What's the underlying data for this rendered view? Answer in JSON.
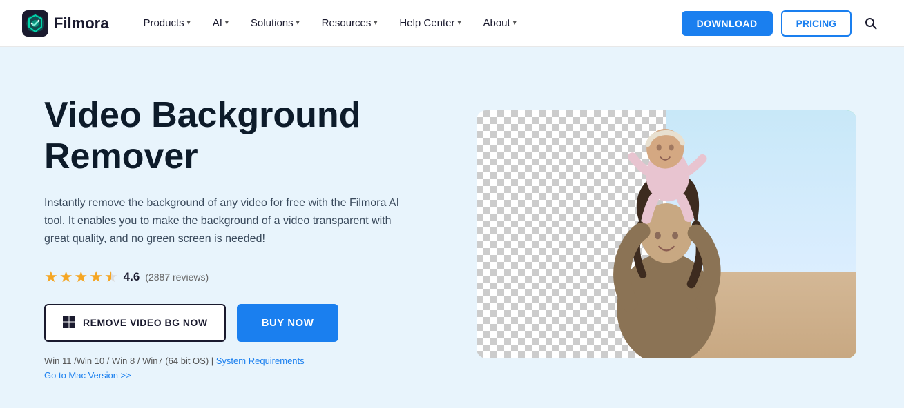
{
  "nav": {
    "logo_text": "Filmora",
    "items": [
      {
        "label": "Products",
        "has_dropdown": true
      },
      {
        "label": "AI",
        "has_dropdown": true
      },
      {
        "label": "Solutions",
        "has_dropdown": true
      },
      {
        "label": "Resources",
        "has_dropdown": true
      },
      {
        "label": "Help Center",
        "has_dropdown": true
      },
      {
        "label": "About",
        "has_dropdown": true
      }
    ],
    "download_label": "DOWNLOAD",
    "pricing_label": "PRICING"
  },
  "hero": {
    "title": "Video Background Remover",
    "description": "Instantly remove the background of any video for free with the Filmora AI tool. It enables you to make the background of a video transparent with great quality, and no green screen is needed!",
    "rating_value": "4.6",
    "rating_count": "(2887 reviews)",
    "btn_remove_label": "REMOVE VIDEO BG NOW",
    "btn_buy_label": "BUY NOW",
    "sys_req_text": "Win 11 /Win 10 / Win 8 / Win7 (64 bit OS) | ",
    "sys_req_link": "System Requirements",
    "mac_link": "Go to Mac Version >>"
  }
}
